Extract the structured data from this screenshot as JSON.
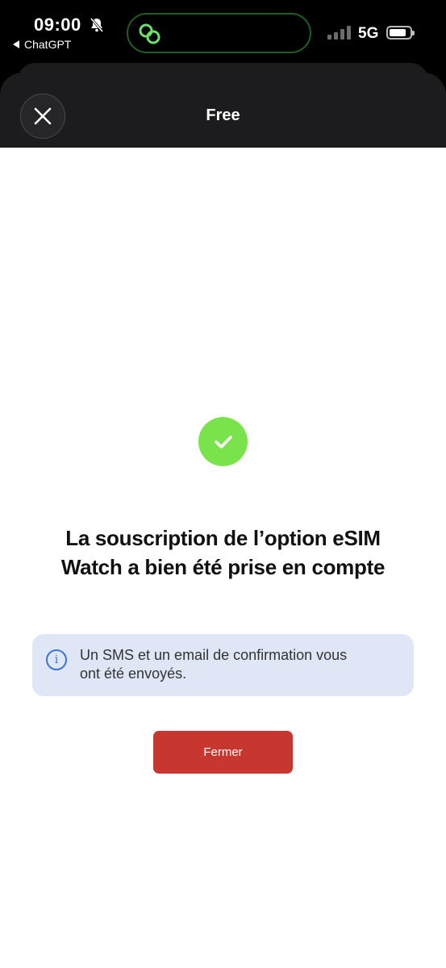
{
  "status_bar": {
    "time": "09:00",
    "back_app": "ChatGPT",
    "network": "5G",
    "battery_level": 0.75,
    "icons": [
      "bell-slash-icon",
      "link-icon",
      "signal-icon",
      "battery-icon"
    ]
  },
  "header": {
    "title": "Free",
    "close_icon": "close-icon"
  },
  "main": {
    "success_icon": "check-icon",
    "title_line1": "La souscription de l’option eSIM",
    "title_line2": "Watch a bien été prise en compte",
    "info": {
      "icon": "info-icon",
      "text_line1": "Un SMS et un email de confirmation vous",
      "text_line2": "ont été envoyés."
    },
    "close_button_label": "Fermer"
  },
  "colors": {
    "success": "#78e34a",
    "primary_button": "#c7372f",
    "info_bg": "#dfe7f7",
    "info_accent": "#3a74d8",
    "header_bg": "#1c1c1e"
  }
}
